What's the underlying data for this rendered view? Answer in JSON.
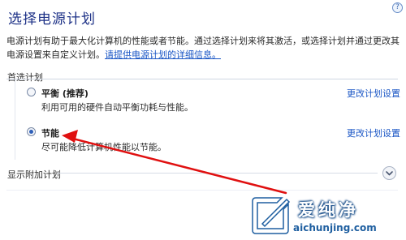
{
  "header": {
    "title": "选择电源计划",
    "help_glyph": "?"
  },
  "description": {
    "text": "电源计划有助于最大化计算机的性能或者节能。通过选择计划来将其激活，或选择计划并通过更改其电源设置来自定义计划。",
    "link": "请提供电源计划的详细信息。"
  },
  "preferred_plans": {
    "label": "首选计划",
    "plans": [
      {
        "name": "平衡 (推荐)",
        "description": "利用可用的硬件自动平衡功耗与性能。",
        "link": "更改计划设置",
        "selected": false
      },
      {
        "name": "节能",
        "description": "尽可能降低计算机性能以节能。",
        "link": "更改计划设置",
        "selected": true
      }
    ]
  },
  "additional": {
    "label": "显示附加计划"
  },
  "watermark": {
    "title": "爱纯净",
    "url": "aichunjing.com"
  },
  "colors": {
    "title": "#1e3287",
    "link": "#1a56c5",
    "arrow": "#e01010",
    "radio_selected": "#2e5fb8"
  },
  "icons": {
    "help": "help-icon",
    "expand": "chevron-down-icon",
    "annotation": "red-arrow-annotation"
  }
}
